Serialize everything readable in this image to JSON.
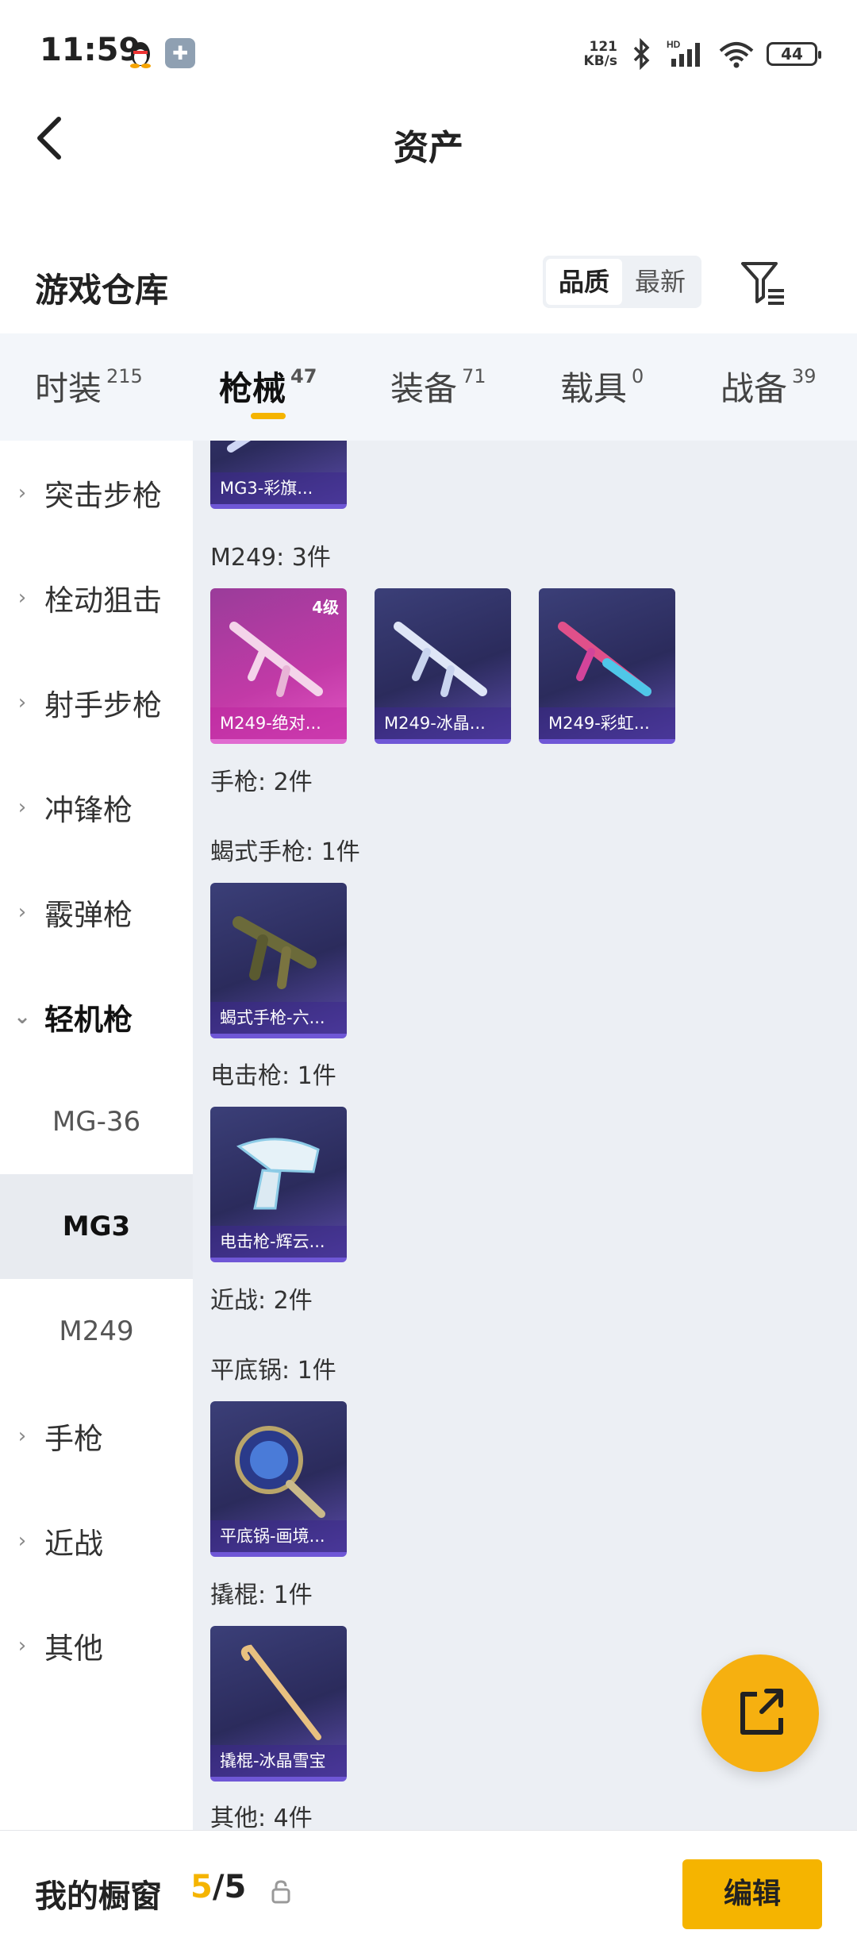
{
  "status_bar": {
    "time": "11:59",
    "speed_value": "121",
    "speed_unit": "KB/s",
    "battery": "44"
  },
  "header": {
    "title": "资产"
  },
  "section": {
    "title": "游戏仓库",
    "sort_quality": "品质",
    "sort_newest": "最新"
  },
  "tabs": [
    {
      "label": "时装",
      "count": "215"
    },
    {
      "label": "枪械",
      "count": "47"
    },
    {
      "label": "装备",
      "count": "71"
    },
    {
      "label": "载具",
      "count": "0"
    },
    {
      "label": "战备",
      "count": "39"
    }
  ],
  "sidebar": {
    "categories": [
      "突击步枪",
      "栓动狙击",
      "射手步枪",
      "冲锋枪",
      "霰弹枪",
      "轻机枪"
    ],
    "subitems": [
      "MG-36",
      "MG3",
      "M249"
    ],
    "categories_after": [
      "手枪",
      "近战",
      "其他"
    ]
  },
  "content": {
    "top_card": "MG3-彩旗...",
    "groups": {
      "m249": "M249: 3件",
      "pistol": "手枪: 2件",
      "scorpion": "蝎式手枪: 1件",
      "taser": "电击枪: 1件",
      "melee": "近战: 2件",
      "pan": "平底锅: 1件",
      "crowbar": "撬棍: 1件",
      "other": "其他: 4件"
    },
    "cards": {
      "m249_1": {
        "name": "M249-绝对...",
        "level": "4级"
      },
      "m249_2": {
        "name": "M249-冰晶..."
      },
      "m249_3": {
        "name": "M249-彩虹..."
      },
      "scorpion_1": {
        "name": "蝎式手枪-六..."
      },
      "taser_1": {
        "name": "电击枪-辉云..."
      },
      "pan_1": {
        "name": "平底锅-画境..."
      },
      "crowbar_1": {
        "name": "撬棍-冰晶雪宝"
      }
    }
  },
  "bottom": {
    "shelf_label": "我的橱窗",
    "shelf_current": "5",
    "shelf_sep": "/",
    "shelf_total": "5",
    "edit_label": "编辑"
  },
  "colors": {
    "accent": "#f5b400",
    "card_purple": "#3b3f78",
    "card_pink": "#c23aa7"
  }
}
